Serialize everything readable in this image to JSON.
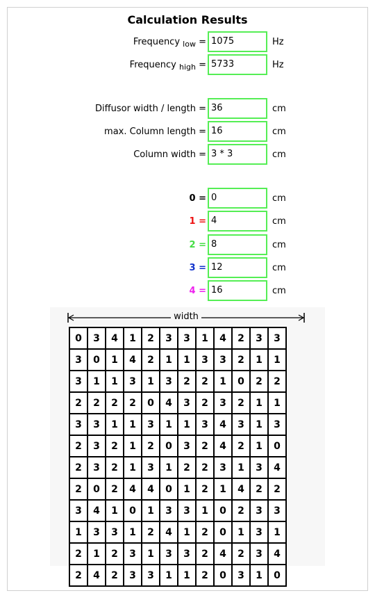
{
  "title": "Calculation Results",
  "frequency": {
    "low": {
      "label": "Frequency",
      "sub": "low",
      "eq": " =",
      "value": "1075",
      "unit": "Hz"
    },
    "high": {
      "label": "Frequency",
      "sub": "high",
      "eq": " =",
      "value": "5733",
      "unit": "Hz"
    }
  },
  "dimensions": [
    {
      "label": "Diffusor width / length =",
      "value": "36",
      "unit": "cm"
    },
    {
      "label": "max. Column length =",
      "value": "16",
      "unit": "cm"
    },
    {
      "label": "Column width =",
      "value": "3 * 3",
      "unit": "cm"
    }
  ],
  "depths": [
    {
      "key": "0",
      "eq": " =",
      "value": "0",
      "unit": "cm",
      "color": "#000000"
    },
    {
      "key": "1",
      "eq": " =",
      "value": "4",
      "unit": "cm",
      "color": "#ee1111"
    },
    {
      "key": "2",
      "eq": " =",
      "value": "8",
      "unit": "cm",
      "color": "#44dd44"
    },
    {
      "key": "3",
      "eq": " =",
      "value": "12",
      "unit": "cm",
      "color": "#1133cc"
    },
    {
      "key": "4",
      "eq": " =",
      "value": "16",
      "unit": "cm",
      "color": "#ee22ee"
    }
  ],
  "width_label": "width",
  "grid": [
    [
      "0",
      "3",
      "4",
      "1",
      "2",
      "3",
      "3",
      "1",
      "4",
      "2",
      "3",
      "3"
    ],
    [
      "3",
      "0",
      "1",
      "4",
      "2",
      "1",
      "1",
      "3",
      "3",
      "2",
      "1",
      "1"
    ],
    [
      "3",
      "1",
      "1",
      "3",
      "1",
      "3",
      "2",
      "2",
      "1",
      "0",
      "2",
      "2"
    ],
    [
      "2",
      "2",
      "2",
      "2",
      "0",
      "4",
      "3",
      "2",
      "3",
      "2",
      "1",
      "1"
    ],
    [
      "3",
      "3",
      "1",
      "1",
      "3",
      "1",
      "1",
      "3",
      "4",
      "3",
      "1",
      "3"
    ],
    [
      "2",
      "3",
      "2",
      "1",
      "2",
      "0",
      "3",
      "2",
      "4",
      "2",
      "1",
      "0"
    ],
    [
      "2",
      "3",
      "2",
      "1",
      "3",
      "1",
      "2",
      "2",
      "3",
      "1",
      "3",
      "4"
    ],
    [
      "2",
      "0",
      "2",
      "4",
      "4",
      "0",
      "1",
      "2",
      "1",
      "4",
      "2",
      "2"
    ],
    [
      "3",
      "4",
      "1",
      "0",
      "1",
      "3",
      "3",
      "1",
      "0",
      "2",
      "3",
      "3"
    ],
    [
      "1",
      "3",
      "3",
      "1",
      "2",
      "4",
      "1",
      "2",
      "0",
      "1",
      "3",
      "1"
    ],
    [
      "2",
      "1",
      "2",
      "3",
      "1",
      "3",
      "3",
      "2",
      "4",
      "2",
      "3",
      "4"
    ],
    [
      "2",
      "4",
      "2",
      "3",
      "3",
      "1",
      "1",
      "2",
      "0",
      "3",
      "1",
      "0"
    ]
  ]
}
